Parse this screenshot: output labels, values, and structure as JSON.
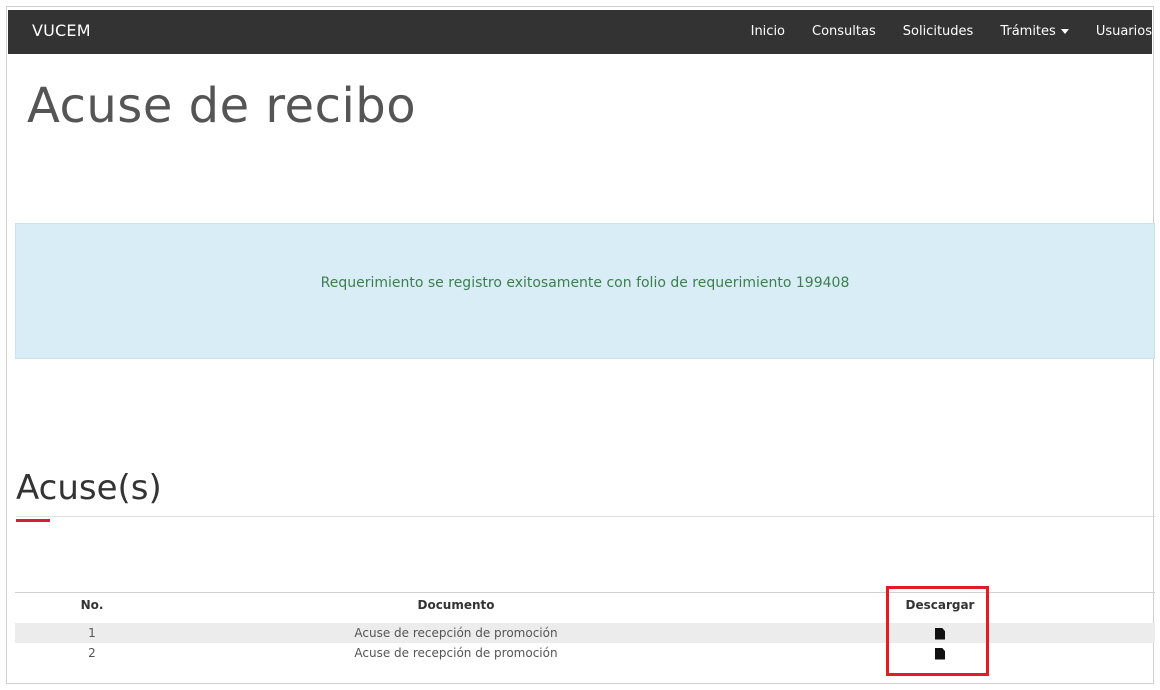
{
  "app": {
    "brand": "VUCEM"
  },
  "nav": {
    "items": [
      {
        "label": "Inicio"
      },
      {
        "label": "Consultas"
      },
      {
        "label": "Solicitudes"
      },
      {
        "label": "Trámites"
      },
      {
        "label": "Usuarios"
      }
    ]
  },
  "page": {
    "title": "Acuse de recibo"
  },
  "alert": {
    "message": "Requerimiento se registro exitosamente con folio de requerimiento 199408"
  },
  "section": {
    "title": "Acuse(s)"
  },
  "table": {
    "headers": {
      "number": "No.",
      "document": "Documento",
      "download": "Descargar"
    },
    "rows": [
      {
        "number": "1",
        "document": "Acuse de recepción de promoción",
        "download_icon": "file-icon"
      },
      {
        "number": "2",
        "document": "Acuse de recepción de promoción",
        "download_icon": "file-icon"
      }
    ]
  },
  "colors": {
    "navbar": "#333333",
    "alert_background": "#d9edf7",
    "accent": "#d21f3c",
    "highlight": "#e31b23"
  }
}
